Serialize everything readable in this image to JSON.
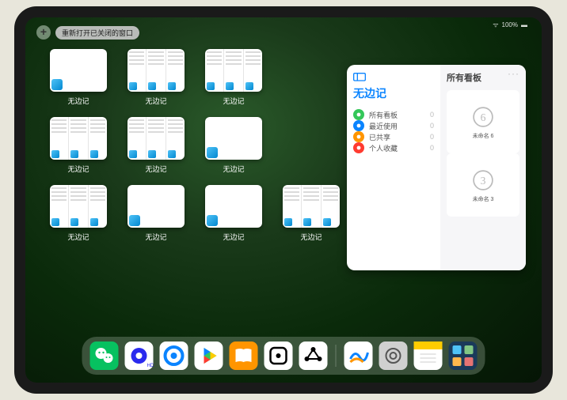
{
  "status": {
    "signal": "100%"
  },
  "top": {
    "add_label": "+",
    "reopen_label": "重新打开已关闭的窗口"
  },
  "app_tiles": {
    "label": "无边记",
    "items": [
      {
        "variant": "blank"
      },
      {
        "variant": "columns"
      },
      {
        "variant": "columns"
      },
      {
        "variant": "blank"
      },
      {
        "variant": "columns"
      },
      {
        "variant": "columns"
      },
      {
        "variant": "blank"
      },
      {
        "variant": "columns"
      },
      {
        "variant": "columns"
      },
      {
        "variant": "blank"
      },
      {
        "variant": "blank"
      },
      {
        "variant": "columns"
      }
    ]
  },
  "panel": {
    "title": "无边记",
    "right_title": "所有看板",
    "more": "···",
    "items": [
      {
        "label": "所有看板",
        "count": "0",
        "color": "#34c759"
      },
      {
        "label": "最近使用",
        "count": "0",
        "color": "#0a84ff"
      },
      {
        "label": "已共享",
        "count": "0",
        "color": "#ff9500"
      },
      {
        "label": "个人收藏",
        "count": "0",
        "color": "#ff3b30"
      }
    ],
    "boards": [
      {
        "sketch": "6",
        "name": "未命名 6"
      },
      {
        "sketch": "3",
        "name": "未命名 3"
      }
    ]
  },
  "dock": {
    "apps": [
      "wechat",
      "quark-hd",
      "qqbrowser",
      "play",
      "books",
      "square-dot",
      "hub",
      "freeform",
      "settings",
      "notes",
      "arranger"
    ]
  }
}
